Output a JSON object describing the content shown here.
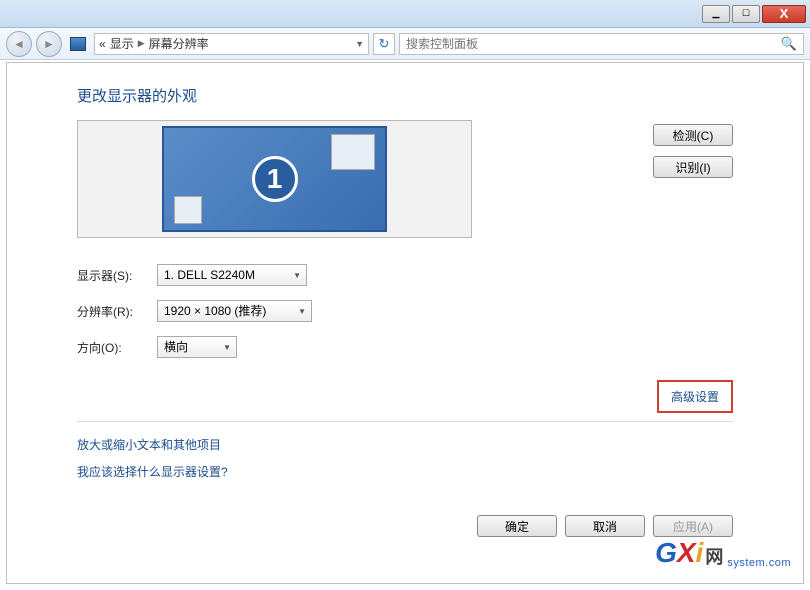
{
  "titlebar": {
    "close": "X"
  },
  "breadcrumb": {
    "prefix": "«",
    "item1": "显示",
    "item2": "屏幕分辨率"
  },
  "search": {
    "placeholder": "搜索控制面板"
  },
  "page": {
    "title": "更改显示器的外观",
    "detect_btn": "检测(C)",
    "identify_btn": "识别(I)",
    "display_num": "1"
  },
  "form": {
    "display_label": "显示器(S):",
    "display_value": "1. DELL S2240M",
    "resolution_label": "分辨率(R):",
    "resolution_value": "1920 × 1080 (推荐)",
    "orientation_label": "方向(O):",
    "orientation_value": "横向"
  },
  "links": {
    "advanced": "高级设置",
    "text_size": "放大或缩小文本和其他项目",
    "help": "我应该选择什么显示器设置?"
  },
  "buttons": {
    "ok": "确定",
    "cancel": "取消",
    "apply": "应用(A)"
  },
  "watermark": {
    "g": "G",
    "x": "X",
    "i": "i",
    "net": "网",
    "url": "system.com"
  }
}
